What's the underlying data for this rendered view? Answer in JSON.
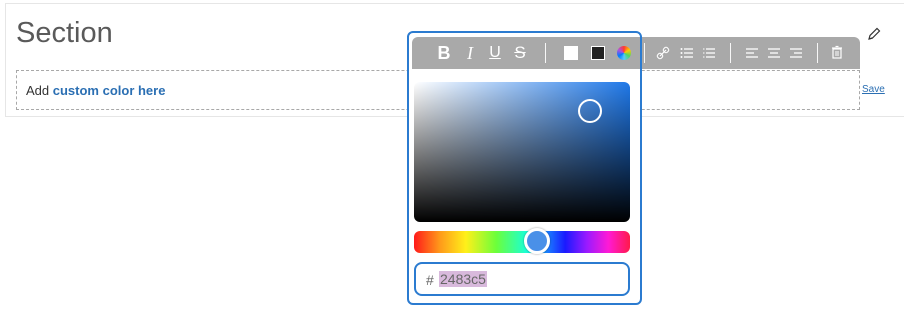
{
  "section": {
    "title": "Section",
    "edit_icon": "pencil-icon"
  },
  "editor": {
    "text_prefix": "Add ",
    "text_bold": "custom color here",
    "save_label": "Save"
  },
  "toolbar": {
    "bold": "B",
    "italic": "I",
    "underline": "U",
    "strikethrough": "S",
    "icons": [
      "color-white-icon",
      "color-black-icon",
      "color-wheel-icon",
      "link-icon",
      "bullet-list-icon",
      "numbered-list-icon",
      "align-left-icon",
      "align-center-icon",
      "align-right-icon",
      "trash-icon"
    ]
  },
  "color_picker": {
    "hash": "#",
    "hex_value": "2483c5",
    "hue_color": "#1f78e8",
    "accent": "#2b7bd0"
  }
}
